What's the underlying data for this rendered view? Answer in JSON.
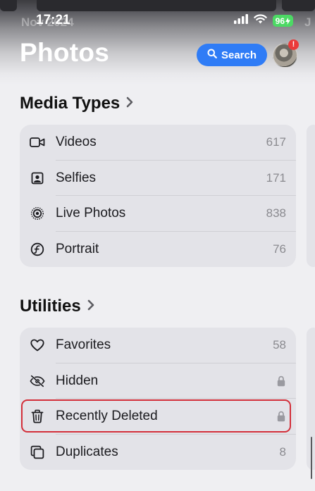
{
  "status_bar": {
    "time": "17:21",
    "battery": "96"
  },
  "background": {
    "date_left": "Nov 2024",
    "date_right": "J"
  },
  "header": {
    "title": "Photos",
    "search_label": "Search",
    "avatar_badge": "!"
  },
  "media_types": {
    "title": "Media Types",
    "items": [
      {
        "label": "Videos",
        "count": "617",
        "icon": "video-icon"
      },
      {
        "label": "Selfies",
        "count": "171",
        "icon": "selfie-icon"
      },
      {
        "label": "Live Photos",
        "count": "838",
        "icon": "live-photo-icon"
      },
      {
        "label": "Portrait",
        "count": "76",
        "icon": "portrait-icon"
      }
    ]
  },
  "utilities": {
    "title": "Utilities",
    "items": [
      {
        "label": "Favorites",
        "count": "58",
        "icon": "heart-icon"
      },
      {
        "label": "Hidden",
        "locked": true,
        "icon": "eye-slash-icon"
      },
      {
        "label": "Recently Deleted",
        "locked": true,
        "icon": "trash-icon",
        "highlighted": true
      },
      {
        "label": "Duplicates",
        "count": "8",
        "icon": "duplicate-icon"
      }
    ]
  },
  "colors": {
    "accent": "#2f7cf6",
    "highlight": "#d32f3a",
    "badge": "#ea3a3a",
    "battery": "#4cd964"
  }
}
